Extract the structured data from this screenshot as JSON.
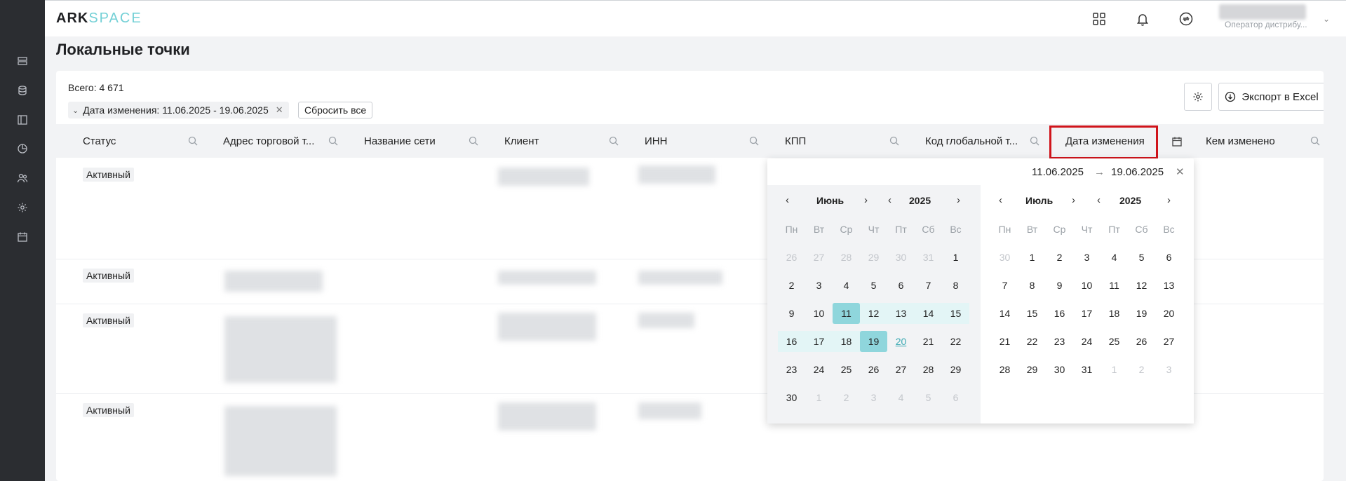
{
  "header": {
    "logo_ark": "ARK",
    "logo_space": "SPACE",
    "user_role": "Оператор дистрибу..."
  },
  "page": {
    "title": "Локальные точки"
  },
  "toolbar": {
    "total": "Всего: 4 671",
    "filter_chip": "Дата изменения: 11.06.2025 - 19.06.2025",
    "reset_label": "Сбросить все",
    "export_label": "Экспорт в Excel"
  },
  "table": {
    "columns": [
      "Статус",
      "Адрес торговой т...",
      "Название сети",
      "Клиент",
      "ИНН",
      "КПП",
      "Код глобальной т...",
      "Дата изменения",
      "Кем изменено"
    ],
    "rows": [
      {
        "status": "Активный"
      },
      {
        "status": "Активный"
      },
      {
        "status": "Активный"
      },
      {
        "status": "Активный"
      }
    ]
  },
  "datepicker": {
    "start": "11.06.2025",
    "end": "19.06.2025",
    "arrow": "→",
    "weekdays": [
      "Пн",
      "Вт",
      "Ср",
      "Чт",
      "Пт",
      "Сб",
      "Вс"
    ],
    "months": [
      {
        "name": "Июнь",
        "year": "2025",
        "weeks": [
          [
            "26",
            "27",
            "28",
            "29",
            "30",
            "31",
            "1"
          ],
          [
            "2",
            "3",
            "4",
            "5",
            "6",
            "7",
            "8"
          ],
          [
            "9",
            "10",
            "11",
            "12",
            "13",
            "14",
            "15"
          ],
          [
            "16",
            "17",
            "18",
            "19",
            "20",
            "21",
            "22"
          ],
          [
            "23",
            "24",
            "25",
            "26",
            "27",
            "28",
            "29"
          ],
          [
            "30",
            "1",
            "2",
            "3",
            "4",
            "5",
            "6"
          ]
        ]
      },
      {
        "name": "Июль",
        "year": "2025",
        "weeks": [
          [
            "30",
            "1",
            "2",
            "3",
            "4",
            "5",
            "6"
          ],
          [
            "7",
            "8",
            "9",
            "10",
            "11",
            "12",
            "13"
          ],
          [
            "14",
            "15",
            "16",
            "17",
            "18",
            "19",
            "20"
          ],
          [
            "21",
            "22",
            "23",
            "24",
            "25",
            "26",
            "27"
          ],
          [
            "28",
            "29",
            "30",
            "31",
            "1",
            "2",
            "3"
          ]
        ]
      }
    ]
  }
}
